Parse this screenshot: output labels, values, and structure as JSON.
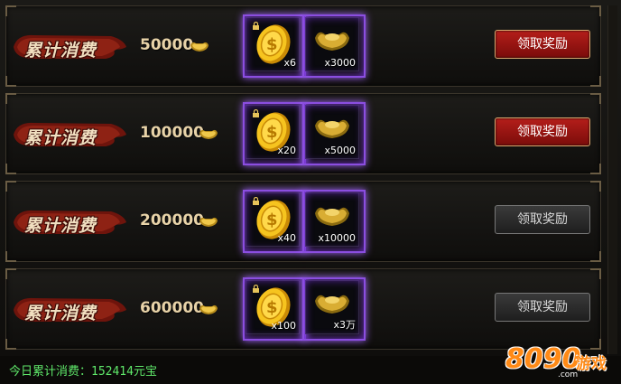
{
  "colors": {
    "accent_red": "#b51e1a",
    "gold_text": "#e8d3a8",
    "footer_green": "#5fe86a",
    "purple_glow": "#a365ff"
  },
  "rows": [
    {
      "label": "累计消费",
      "amount": "50000",
      "rewards": [
        {
          "icon": "gold-coin-icon",
          "qty": "x6",
          "locked": true
        },
        {
          "icon": "gold-ingot-icon",
          "qty": "x3000"
        }
      ],
      "button": "领取奖励",
      "active": true
    },
    {
      "label": "累计消费",
      "amount": "100000",
      "rewards": [
        {
          "icon": "gold-coin-icon",
          "qty": "x20",
          "locked": true
        },
        {
          "icon": "gold-ingot-icon",
          "qty": "x5000"
        }
      ],
      "button": "领取奖励",
      "active": true
    },
    {
      "label": "累计消费",
      "amount": "200000",
      "rewards": [
        {
          "icon": "gold-coin-icon",
          "qty": "x40",
          "locked": true
        },
        {
          "icon": "gold-ingot-icon",
          "qty": "x10000"
        }
      ],
      "button": "领取奖励",
      "active": false
    },
    {
      "label": "累计消费",
      "amount": "600000",
      "rewards": [
        {
          "icon": "gold-coin-icon",
          "qty": "x100",
          "locked": true
        },
        {
          "icon": "gold-ingot-icon",
          "qty": "x3万"
        }
      ],
      "button": "领取奖励",
      "active": false
    }
  ],
  "footer": {
    "text": "今日累计消费：152414元宝"
  },
  "watermark": {
    "number": "8090",
    "text": "游戏",
    "domain": ".com"
  }
}
